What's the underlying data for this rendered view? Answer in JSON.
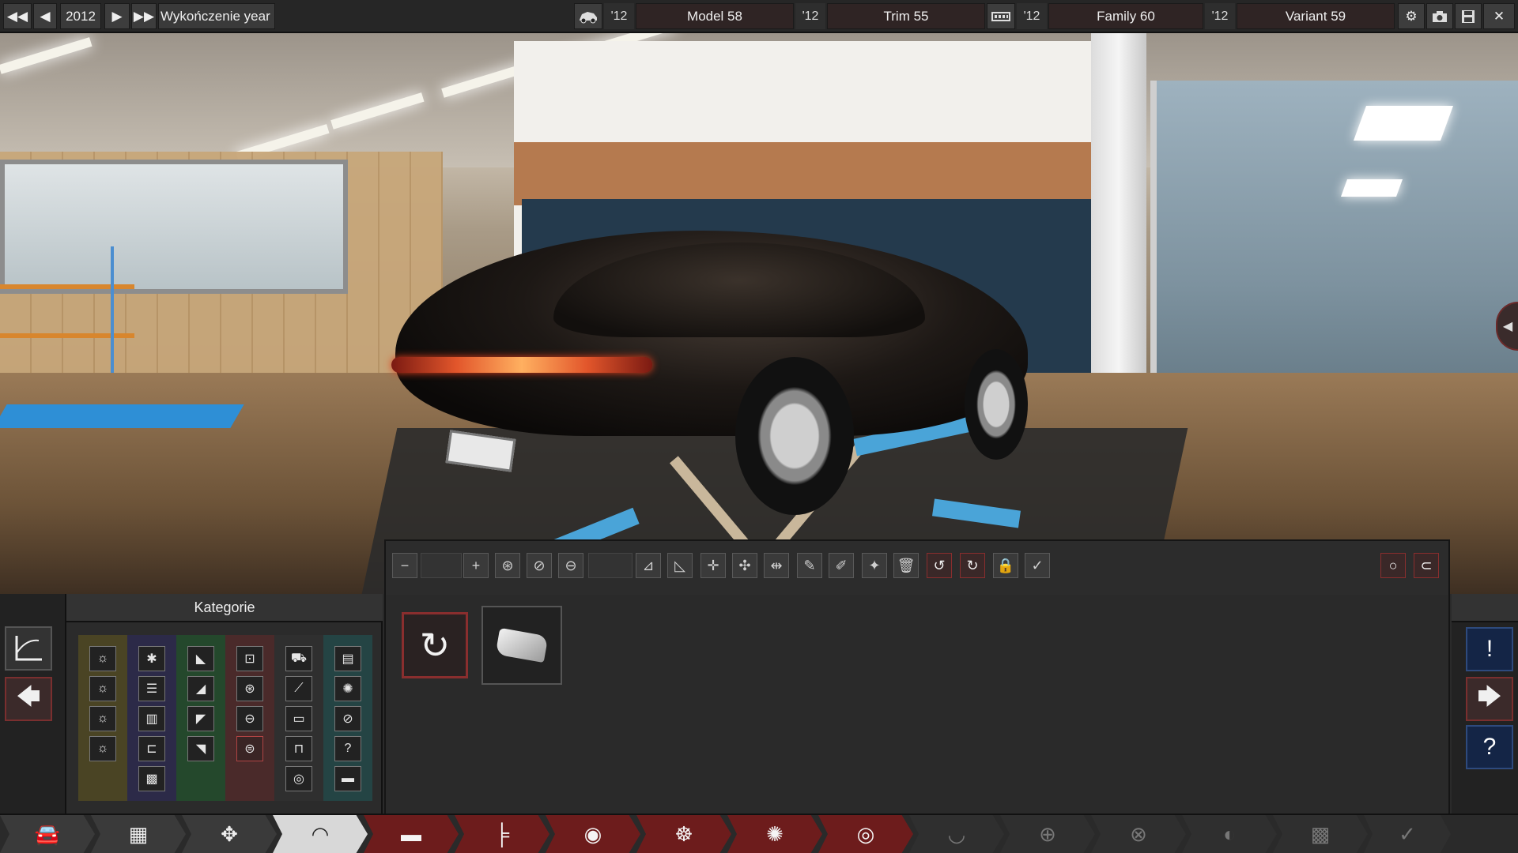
{
  "top_bar": {
    "year_value": "2012",
    "year_label": "Wykończenie year",
    "model": {
      "year": "'12",
      "name": "Model 58"
    },
    "trim": {
      "year": "'12",
      "name": "Trim 55"
    },
    "family": {
      "year": "'12",
      "name": "Family 60"
    },
    "variant": {
      "year": "'12",
      "name": "Variant 59"
    },
    "icons": [
      "fast-back-icon",
      "back-icon",
      "forward-icon",
      "fast-forward-icon",
      "car-icon",
      "engine-icon",
      "settings-icon",
      "camera-icon",
      "save-icon",
      "close-icon"
    ]
  },
  "category_panel": {
    "title": "Kategorie",
    "column_colors": [
      "#4a4424",
      "#2c2a48",
      "#24482c",
      "#4a2a2a",
      "#2f2f2f",
      "#244444"
    ]
  },
  "colors": {
    "accent_red": "#8a2e2e",
    "help_blue": "#142546",
    "nav_active": "#d8d8d8"
  },
  "nav_steps": [
    {
      "icon": "car-front-icon",
      "state": "done"
    },
    {
      "icon": "chassis-icon",
      "state": "done"
    },
    {
      "icon": "suspension-icon",
      "state": "done"
    },
    {
      "icon": "body-shape-icon",
      "state": "active"
    },
    {
      "icon": "trim-icon",
      "state": "red"
    },
    {
      "icon": "interior-icon",
      "state": "red"
    },
    {
      "icon": "fixtures-icon",
      "state": "red"
    },
    {
      "icon": "brakes-icon",
      "state": "red"
    },
    {
      "icon": "wheels-icon",
      "state": "red"
    },
    {
      "icon": "tires-icon",
      "state": "red"
    },
    {
      "icon": "aero-icon",
      "state": "gray"
    },
    {
      "icon": "seat-icon",
      "state": "gray"
    },
    {
      "icon": "steering-icon",
      "state": "gray"
    },
    {
      "icon": "test-icon",
      "state": "gray"
    },
    {
      "icon": "race-icon",
      "state": "gray"
    },
    {
      "icon": "finish-check-icon",
      "state": "gray"
    }
  ]
}
